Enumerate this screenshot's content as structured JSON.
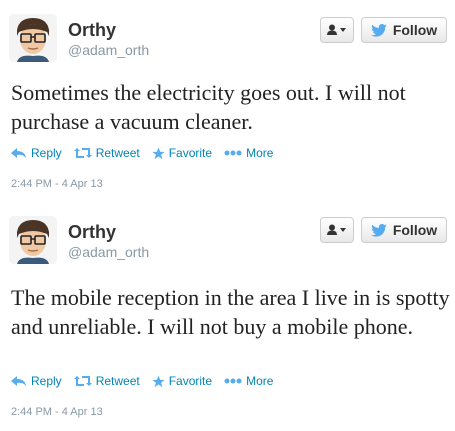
{
  "tweets": [
    {
      "name": "Orthy",
      "handle": "@adam_orth",
      "follow_label": "Follow",
      "text": "Sometimes the electricity goes out. I will not purchase a vacuum cleaner.",
      "actions": {
        "reply": "Reply",
        "retweet": "Retweet",
        "favorite": "Favorite",
        "more": "More"
      },
      "timestamp": "2:44 PM - 4 Apr 13"
    },
    {
      "name": "Orthy",
      "handle": "@adam_orth",
      "follow_label": "Follow",
      "text": "The mobile reception in the area I live in is spotty and unreliable. I will not buy a mobile phone.",
      "actions": {
        "reply": "Reply",
        "retweet": "Retweet",
        "favorite": "Favorite",
        "more": "More"
      },
      "timestamp": "2:44 PM - 4 Apr 13"
    }
  ],
  "colors": {
    "link": "#0084b4",
    "bird": "#55acee",
    "muted": "#8899a6",
    "name": "#333333"
  }
}
